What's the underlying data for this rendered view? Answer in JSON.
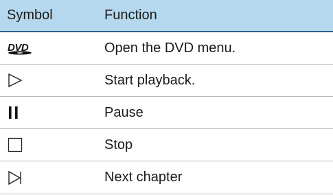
{
  "header": {
    "symbol_label": "Symbol",
    "function_label": "Function"
  },
  "rows": [
    {
      "icon": "dvd-logo-icon",
      "icon_text": "DVD",
      "function": "Open the DVD menu."
    },
    {
      "icon": "play-icon",
      "function": "Start playback."
    },
    {
      "icon": "pause-icon",
      "function": "Pause"
    },
    {
      "icon": "stop-icon",
      "function": "Stop"
    },
    {
      "icon": "next-chapter-icon",
      "function": "Next chapter"
    }
  ],
  "colors": {
    "header_background": "#b5d8ee",
    "header_rule": "#2d5f8a",
    "row_divider": "#b9b9b9"
  }
}
